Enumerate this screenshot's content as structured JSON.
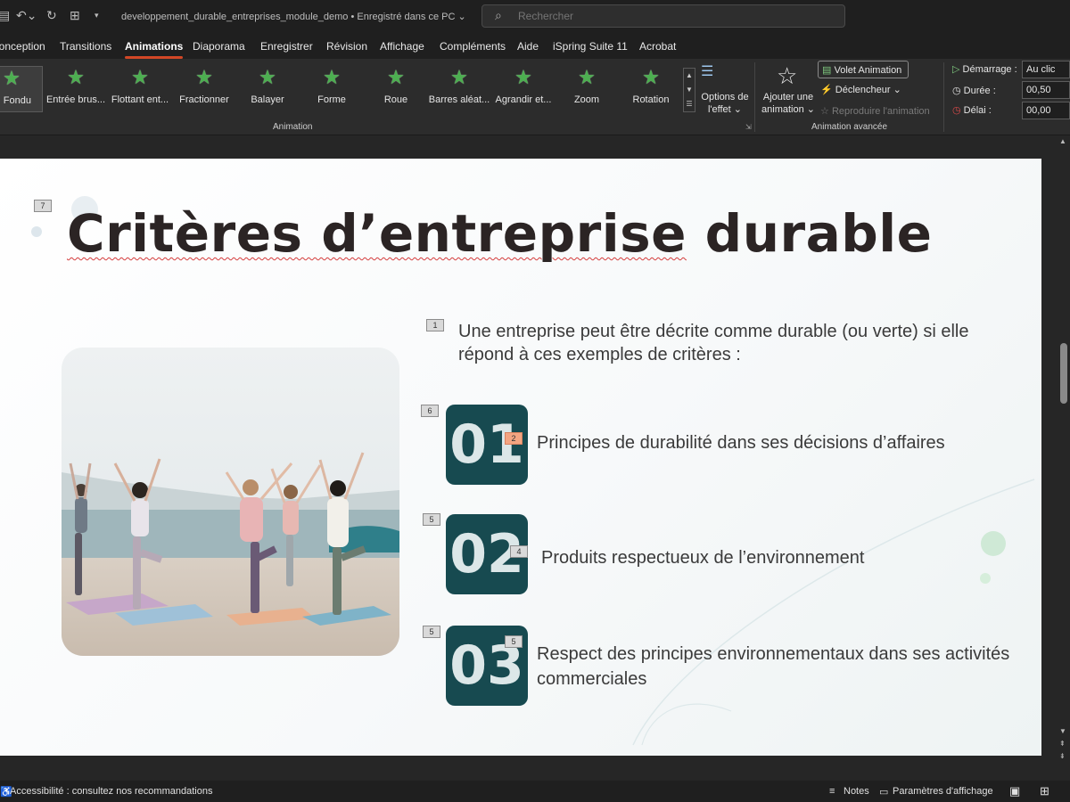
{
  "titlebar": {
    "doc_title": "developpement_durable_entreprises_module_demo • Enregistré dans ce PC ⌄",
    "search_placeholder": "Rechercher"
  },
  "tabs": [
    {
      "label": "Conception",
      "active": false
    },
    {
      "label": "Transitions",
      "active": false
    },
    {
      "label": "Animations",
      "active": true
    },
    {
      "label": "Diaporama",
      "active": false
    },
    {
      "label": "Enregistrer",
      "active": false
    },
    {
      "label": "Révision",
      "active": false
    },
    {
      "label": "Affichage",
      "active": false
    },
    {
      "label": "Compléments",
      "active": false
    },
    {
      "label": "Aide",
      "active": false
    },
    {
      "label": "iSpring Suite 11",
      "active": false
    },
    {
      "label": "Acrobat",
      "active": false
    }
  ],
  "ribbon": {
    "effects": [
      {
        "label": "Fondu",
        "selected": true
      },
      {
        "label": "Entrée brus...",
        "selected": false
      },
      {
        "label": "Flottant ent...",
        "selected": false
      },
      {
        "label": "Fractionner",
        "selected": false
      },
      {
        "label": "Balayer",
        "selected": false
      },
      {
        "label": "Forme",
        "selected": false
      },
      {
        "label": "Roue",
        "selected": false
      },
      {
        "label": "Barres aléat...",
        "selected": false
      },
      {
        "label": "Agrandir et...",
        "selected": false
      },
      {
        "label": "Zoom",
        "selected": false
      },
      {
        "label": "Rotation",
        "selected": false
      }
    ],
    "effect_options_line1": "Options de",
    "effect_options_line2": "l'effet ⌄",
    "animation_group_label": "Animation",
    "add_animation_line1": "Ajouter une",
    "add_animation_line2": "animation ⌄",
    "volet_animation": "Volet Animation",
    "declencheur": "Déclencheur ⌄",
    "reproduire": "Reproduire l'animation",
    "advanced_group_label": "Animation avancée",
    "demarrage_label": "Démarrage :",
    "demarrage_value": "Au clic",
    "duree_label": "Durée :",
    "duree_value": "00,50",
    "delai_label": "Délai :",
    "delai_value": "00,00"
  },
  "slide": {
    "title_part1": "Critères d’entreprise",
    "title_part2": " durable",
    "intro": "Une entreprise peut être décrite comme durable (ou verte) si elle répond à ces exemples de critères :",
    "criteria": [
      {
        "number": "01",
        "text": "Principes de durabilité dans ses décisions d’affaires"
      },
      {
        "number": "02",
        "text": "Produits respectueux de l’environnement"
      },
      {
        "number": "03",
        "text": "Respect des principes environnementaux dans ses activités commerciales"
      }
    ],
    "anim_tags": {
      "title": "7",
      "intro": "1",
      "box1": "6",
      "num1": "2",
      "box2": "5",
      "num2": "4",
      "box3": "5",
      "num3": "5"
    }
  },
  "statusbar": {
    "accessibility": "Accessibilité : consultez nos recommandations",
    "notes": "Notes",
    "display_settings": "Paramètres d'affichage"
  },
  "colors": {
    "accent_tab": "#d24726",
    "number_box": "#174a50",
    "star_green": "#4caf50"
  }
}
